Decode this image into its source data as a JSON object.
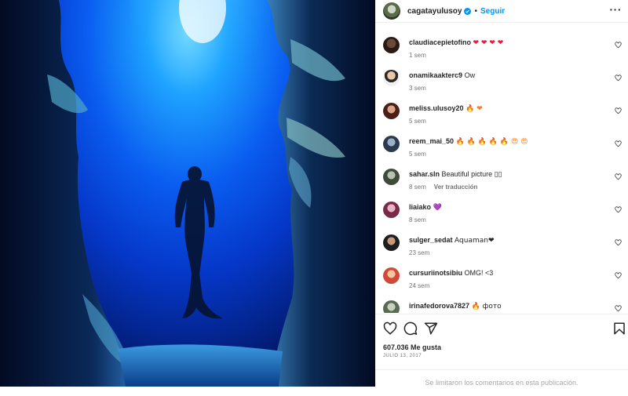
{
  "post": {
    "image_description_icon": "freediver-cave-photo"
  },
  "header": {
    "username": "cagatayulusoy",
    "separator": "•",
    "follow_label": "Seguir",
    "more_icon": "more-horizontal-icon"
  },
  "comments": [
    {
      "user": "claudiacepietofino",
      "text": "❤ ❤ ❤ ❤",
      "time": "1 sem",
      "extra": ""
    },
    {
      "user": "onamikaakterc9",
      "text": "Ow",
      "time": "3 sem",
      "extra": ""
    },
    {
      "user": "meliss.ulusoy20",
      "text": "🔥 ❤",
      "time": "5 sem",
      "extra": ""
    },
    {
      "user": "reem_mai_50",
      "text": "🔥 🔥 🔥 🔥 🔥 😍 😍",
      "time": "5 sem",
      "extra": ""
    },
    {
      "user": "sahar.sln",
      "text": "Beautiful picture ▯▯",
      "time": "8 sem",
      "extra": "Ver traducción"
    },
    {
      "user": "liaiako",
      "text": "💜",
      "time": "8 sem",
      "extra": ""
    },
    {
      "user": "sulger_sedat",
      "text": "Aquaman❤",
      "time": "23 sem",
      "extra": ""
    },
    {
      "user": "cursuriinotsibiu",
      "text": "OMG! <3",
      "time": "24 sem",
      "extra": ""
    },
    {
      "user": "irinafedorova7827",
      "text": "🔥 фото",
      "time": "",
      "extra": ""
    }
  ],
  "actions": {
    "like_icon": "heart-icon",
    "comment_icon": "comment-icon",
    "share_icon": "share-icon",
    "save_icon": "bookmark-icon",
    "likes": "607.036 Me gusta",
    "date": "JULIO 13, 2017",
    "limited_text": "Se limitaron los comentarios en esta publicación."
  },
  "colors": {
    "accent": "#0095f6",
    "heart": "#ed1c3c",
    "muted": "#737373",
    "water_light": "#7fe0ff",
    "water_deep": "#0537c8"
  }
}
